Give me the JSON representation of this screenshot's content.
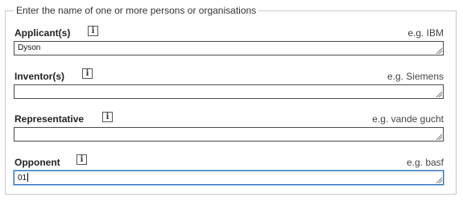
{
  "fieldset": {
    "legend": "Enter the name of one or more persons or organisations"
  },
  "fields": [
    {
      "label": "Applicant(s)",
      "info_glyph": "i",
      "info_icon": "info-icon",
      "example": "e.g. IBM",
      "value": "Dyson",
      "focused": false
    },
    {
      "label": "Inventor(s)",
      "info_glyph": "i",
      "info_icon": "info-icon",
      "example": "e.g. Siemens",
      "value": "",
      "focused": false
    },
    {
      "label": "Representative",
      "info_glyph": "i",
      "info_icon": "info-icon",
      "example": "e.g. vande gucht",
      "value": "",
      "focused": false
    },
    {
      "label": "Opponent",
      "info_glyph": "i",
      "info_icon": "info-icon",
      "example": "e.g. basf",
      "value": "01",
      "focused": true
    }
  ],
  "colors": {
    "focus_border": "#2f6fbd",
    "input_border": "#4a4a4a",
    "fieldset_border": "#c8c8c8"
  }
}
